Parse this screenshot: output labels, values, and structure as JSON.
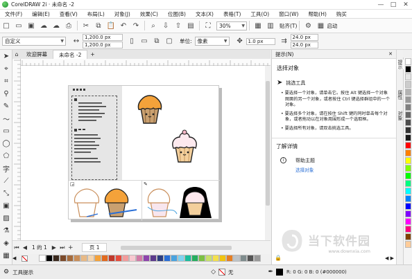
{
  "titlebar": {
    "app_title": "CorelDRAW 2i · 未命名 -2",
    "min": "—",
    "max": "□",
    "close": "✕"
  },
  "menu": [
    "文件(F)",
    "编辑(E)",
    "查看(V)",
    "布局(L)",
    "对象(J)",
    "效果(C)",
    "位图(B)",
    "文本(X)",
    "表格(T)",
    "工具(O)",
    "窗口(W)",
    "帮助(H)",
    "购买"
  ],
  "stdbar": {
    "zoom": "30%",
    "snap_label": "贴齐(T)",
    "launch_label": "启动"
  },
  "propbar": {
    "preset": "自定义",
    "width": "1,200.0 px",
    "height": "1,200.0 px",
    "units_label": "单位:",
    "units_value": "像素",
    "nudge": "1.0 px",
    "dup_x": "24.0 px",
    "dup_y": "24.0 px"
  },
  "tabs": {
    "welcome": "欢迎屏幕",
    "doc": "未命名 -2",
    "add": "+"
  },
  "pager": {
    "of": "1 的 1",
    "page_tab": "页 1"
  },
  "docker": {
    "title": "提示(N)",
    "section": "选择对象",
    "tool_name": "挑选工具",
    "bullets": [
      "要选择一个对象，请单击它。按住 Alt 键选择一个对象图面的另一个对象，或者按住 Ctrl 键选择群组中的一个对象。",
      "要选择多个对象，请在按住 Shift 键的同时单击每个对象，或者拖动以在对象周围形成一个选取框。",
      "要选择所有对象，请双击挑选工具。"
    ],
    "learn_more": "了解详情",
    "help_topic": "帮助主题",
    "help_link": "选择对象",
    "side_tabs": [
      "提示",
      "属性",
      "对象"
    ]
  },
  "status": {
    "tool_hint": "工具提示",
    "fill_none": "无",
    "color_readout": "R: 0 G: 0 B: 0 (#000000)"
  },
  "watermark": {
    "brand": "当下软件园",
    "url": "www.downxia.com"
  },
  "colors": {
    "accent_orange": "#f4a23a",
    "selection_blue": "#2a6fd6"
  },
  "palette": [
    "#ffffff",
    "#000000",
    "#3b2a1e",
    "#7b4a2a",
    "#a56b3c",
    "#c98e5a",
    "#e8b985",
    "#f5d6b0",
    "#f4a23a",
    "#e26a1e",
    "#c0392b",
    "#e74c3c",
    "#f39c9c",
    "#f8c8d0",
    "#d17aa6",
    "#8e44ad",
    "#5b3a8c",
    "#2c3e80",
    "#2a6fd6",
    "#4aa3df",
    "#7fd3f0",
    "#1abc9c",
    "#27ae60",
    "#7bc043",
    "#c8e06b",
    "#f4e04d",
    "#f1c40f",
    "#e67e22",
    "#bdc3c7",
    "#7f8c8d",
    "#555555",
    "#999999"
  ],
  "right_palette": [
    "#ffffff",
    "#000000",
    "#e6e6e6",
    "#cccccc",
    "#b3b3b3",
    "#999999",
    "#808080",
    "#666666",
    "#4d4d4d",
    "#333333",
    "#1a1a1a",
    "#ff0000",
    "#ff8000",
    "#ffff00",
    "#80ff00",
    "#00ff00",
    "#00ff80",
    "#00ffff",
    "#0080ff",
    "#0000ff",
    "#8000ff",
    "#ff00ff",
    "#ff0080",
    "#804000",
    "#ffcc99"
  ]
}
